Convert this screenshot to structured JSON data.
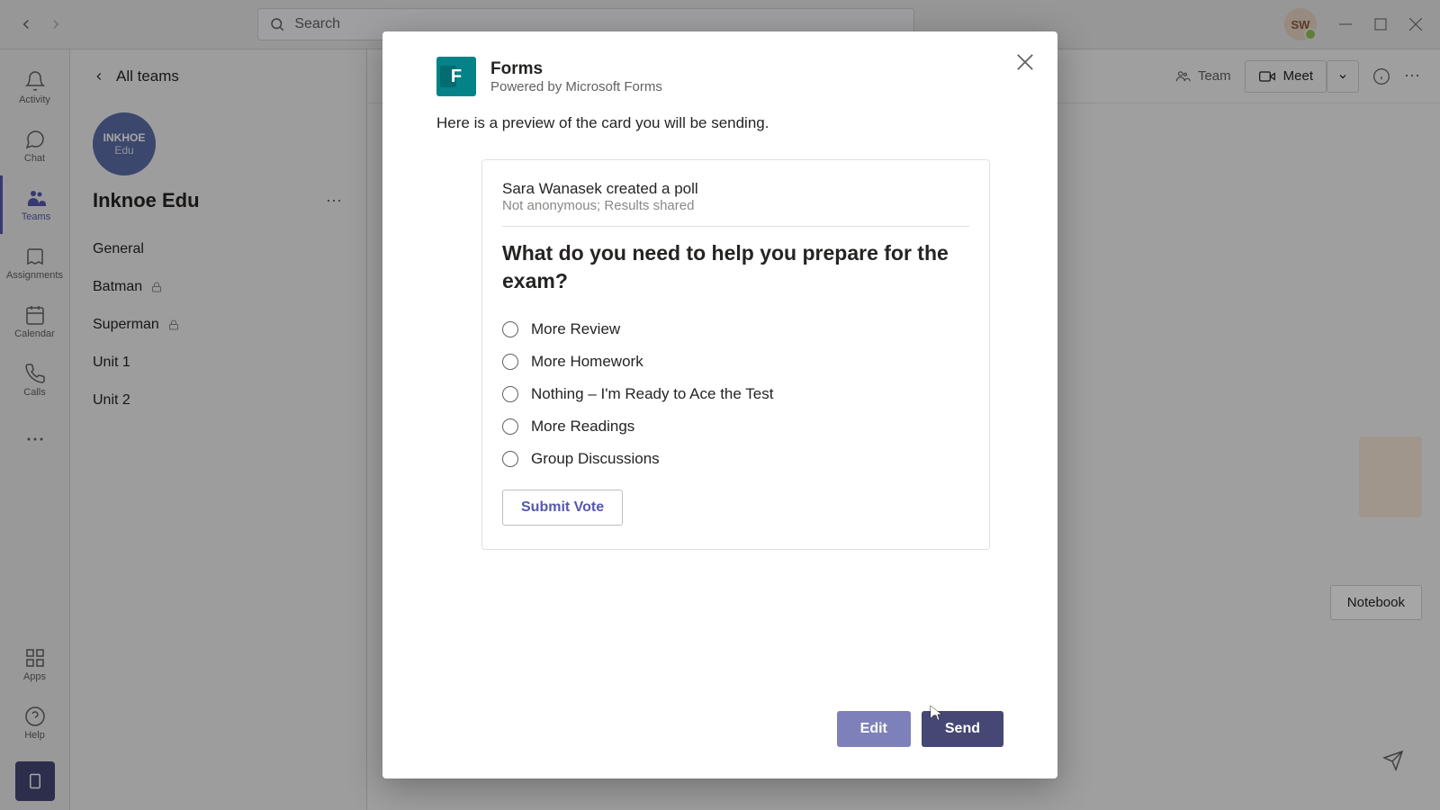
{
  "titlebar": {
    "search_placeholder": "Search",
    "user_initials": "SW"
  },
  "rail": {
    "activity": "Activity",
    "chat": "Chat",
    "teams": "Teams",
    "assignments": "Assignments",
    "calendar": "Calendar",
    "calls": "Calls",
    "apps": "Apps",
    "help": "Help"
  },
  "sidebar": {
    "all_teams": "All teams",
    "team_logo_top": "INKHOE",
    "team_logo_bottom": "Edu",
    "team_name": "Inknoe Edu",
    "channels": [
      {
        "label": "General",
        "locked": false
      },
      {
        "label": "Batman",
        "locked": true
      },
      {
        "label": "Superman",
        "locked": true
      },
      {
        "label": "Unit 1",
        "locked": false
      },
      {
        "label": "Unit 2",
        "locked": false
      }
    ]
  },
  "header": {
    "team_label": "Team",
    "meet_label": "Meet"
  },
  "content": {
    "notebook_label": "Notebook"
  },
  "modal": {
    "title": "Forms",
    "subtitle": "Powered by Microsoft Forms",
    "description": "Here is a preview of the card you will be sending.",
    "poll": {
      "author": "Sara Wanasek created a poll",
      "meta": "Not anonymous; Results shared",
      "question": "What do you need to help you prepare for the exam?",
      "options": [
        "More Review",
        "More Homework",
        "Nothing – I'm Ready to Ace the Test",
        "More Readings",
        "Group Discussions"
      ],
      "submit_label": "Submit Vote"
    },
    "edit_label": "Edit",
    "send_label": "Send"
  }
}
